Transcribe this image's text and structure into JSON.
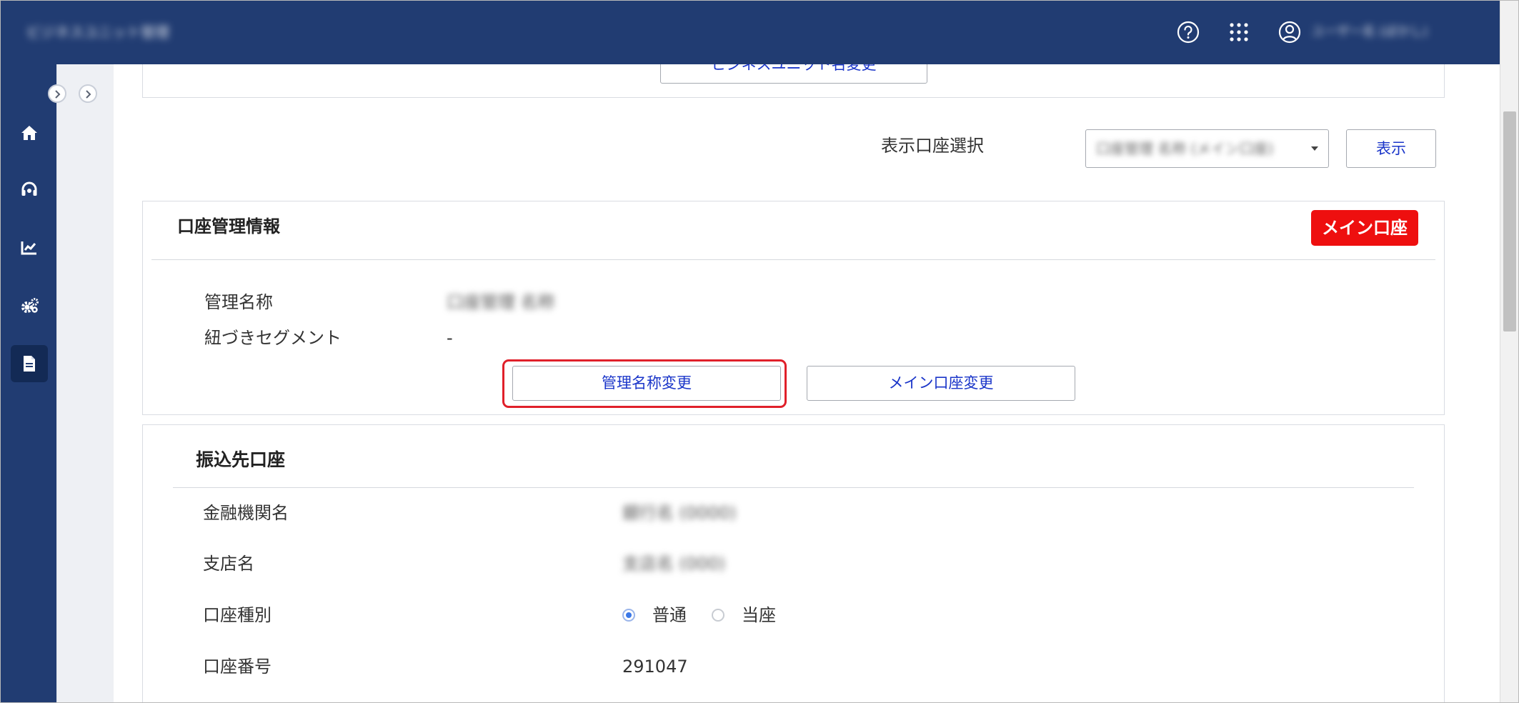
{
  "header": {
    "app_title": "ビジネスユニット管理",
    "user_name": "ユーザー名 (ぼかし)",
    "icons": [
      "help-icon",
      "apps-grid-icon",
      "user-icon"
    ]
  },
  "sidebar": {
    "items": [
      {
        "name": "home",
        "icon": "home-icon"
      },
      {
        "name": "support",
        "icon": "headset-icon"
      },
      {
        "name": "analytics",
        "icon": "chart-icon"
      },
      {
        "name": "settings",
        "icon": "gears-icon"
      },
      {
        "name": "documents",
        "icon": "document-icon",
        "active": true
      }
    ]
  },
  "top_panel": {
    "button_label": "ビジネスユニット名変更"
  },
  "account_select": {
    "label": "表示口座選択",
    "selected_value": "口座管理 名称 (メイン口座)",
    "display_button": "表示"
  },
  "account_info": {
    "title": "口座管理情報",
    "badge": "メイン口座",
    "fields": [
      {
        "label": "管理名称",
        "value": "口座管理 名称"
      },
      {
        "label": "紐づきセグメント",
        "value": "-"
      }
    ],
    "buttons": {
      "rename": "管理名称変更",
      "change_main": "メイン口座変更"
    }
  },
  "transfer_account": {
    "title": "振込先口座",
    "bank_label": "金融機関名",
    "bank_value": "銀行名 (0000)",
    "branch_label": "支店名",
    "branch_value": "支店名 (000)",
    "type_label": "口座種別",
    "type_options": [
      "普通",
      "当座"
    ],
    "type_selected": "普通",
    "number_label": "口座番号",
    "number_value": "291047"
  },
  "colors": {
    "header_bg": "#213c72",
    "link_blue": "#1a35c9",
    "badge_red": "#ee0f0f",
    "highlight_red": "#e0202a"
  }
}
